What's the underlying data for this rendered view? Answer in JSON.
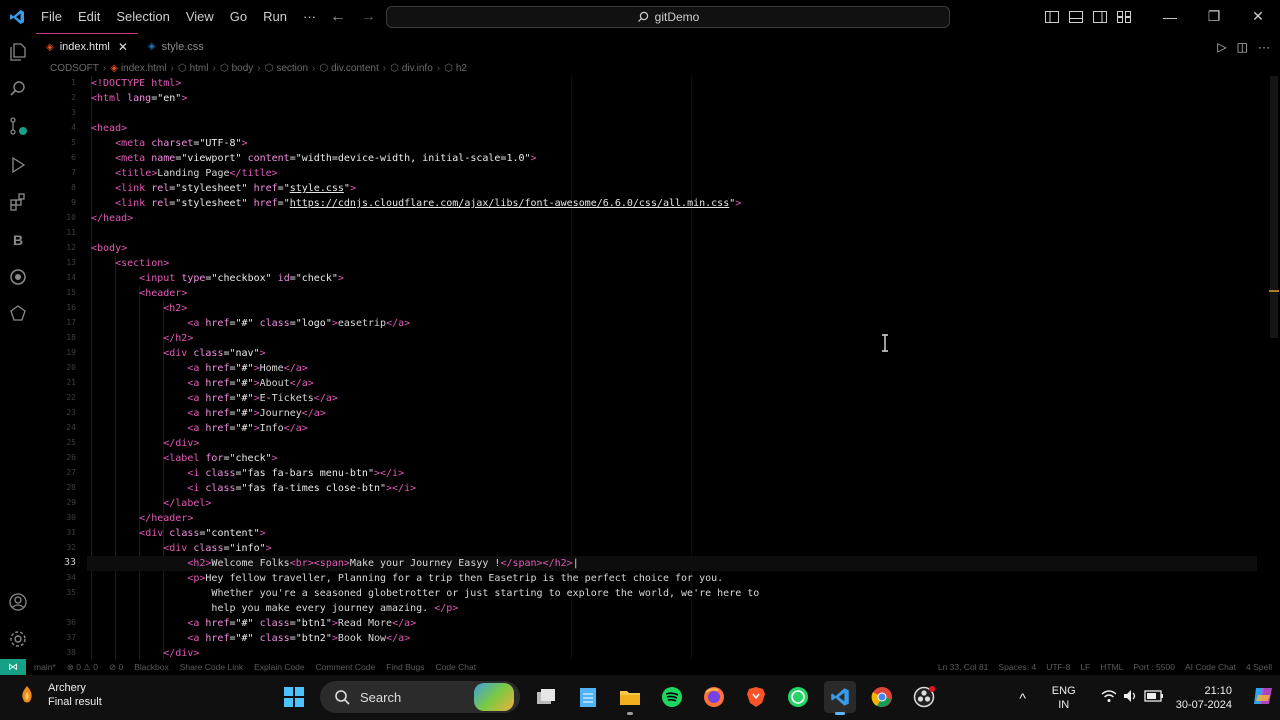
{
  "titlebar": {
    "menu": [
      "File",
      "Edit",
      "Selection",
      "View",
      "Go",
      "Run"
    ],
    "more": "···",
    "search_text": "gitDemo",
    "controls": {
      "minimize": "—",
      "maximize": "❐",
      "close": "✕"
    }
  },
  "tabs": [
    {
      "label": "index.html",
      "active": true,
      "close": "✕"
    },
    {
      "label": "style.css",
      "active": false
    }
  ],
  "breadcrumb": [
    "CODSOFT",
    "index.html",
    "html",
    "body",
    "section",
    "div.content",
    "div.info",
    "h2"
  ],
  "editor": {
    "line_numbers": [
      "1",
      "2",
      "3",
      "4",
      "5",
      "6",
      "7",
      "8",
      "9",
      "10",
      "11",
      "12",
      "13",
      "14",
      "15",
      "16",
      "17",
      "18",
      "19",
      "20",
      "21",
      "22",
      "23",
      "24",
      "25",
      "26",
      "27",
      "28",
      "29",
      "30",
      "31",
      "32",
      "33",
      "34",
      "35",
      "",
      "36",
      "37",
      "38"
    ],
    "current_line": "33"
  },
  "statusbar": {
    "remote": "⋈",
    "left": [
      "main*",
      "⊗ 0 ⚠ 0",
      "⊘ 0",
      "Blackbox",
      "Share Code Link",
      "Explain Code",
      "Comment Code",
      "Find Bugs",
      "Code Chat"
    ],
    "right": [
      "Ln 33, Col 81",
      "Spaces: 4",
      "UTF-8",
      "LF",
      "HTML",
      "Port : 5500",
      "AI Code Chat",
      "4 Spell"
    ]
  },
  "taskbar": {
    "weather_title": "Archery",
    "weather_sub": "Final result",
    "search_label": "Search",
    "lang_top": "ENG",
    "lang_bottom": "IN",
    "time": "21:10",
    "date": "30-07-2024",
    "tray_chevron": "^"
  },
  "colors": {
    "tag": "#e35ab7",
    "attr": "#f08dde",
    "accent": "#16a085",
    "active_tab_border": "#c53a8a"
  }
}
